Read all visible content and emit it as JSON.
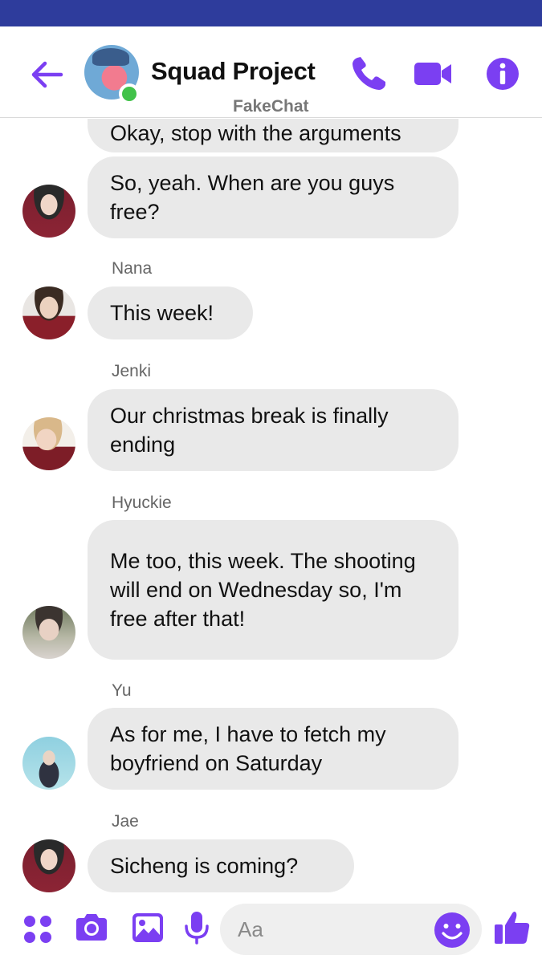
{
  "header": {
    "title": "Squad Project",
    "watermark": "FakeChat",
    "accent_color": "#7b3ff2",
    "status_bar_color": "#2e3c9c",
    "icons": [
      "back-arrow-icon",
      "phone-icon",
      "video-camera-icon",
      "info-icon"
    ]
  },
  "messages": [
    {
      "sender": "",
      "text": "Okay, stop with the arguments",
      "avatar": ""
    },
    {
      "sender": "",
      "text": "So,  yeah. When are you guys free?",
      "avatar": "red-hoodie-avatar"
    },
    {
      "sender": "Nana",
      "text": "This week!",
      "avatar": "red-jacket-avatar"
    },
    {
      "sender": "Jenki",
      "text": "Our christmas break is finally ending",
      "avatar": "blond-avatar"
    },
    {
      "sender": "Hyuckie",
      "text": "Me too, this week. The shooting will end on Wednesday so,  I'm free after that!",
      "avatar": "selfie-avatar"
    },
    {
      "sender": "Yu",
      "text": "As for me, I have to fetch my boyfriend on Saturday",
      "avatar": "blue-background-avatar"
    },
    {
      "sender": "Jae",
      "text": "Sicheng is coming?",
      "avatar": "red-hoodie-avatar"
    }
  ],
  "composer": {
    "placeholder": "Aa",
    "icons": [
      "apps-icon",
      "camera-icon",
      "image-icon",
      "microphone-icon",
      "smiley-icon",
      "thumbs-up-icon"
    ]
  }
}
